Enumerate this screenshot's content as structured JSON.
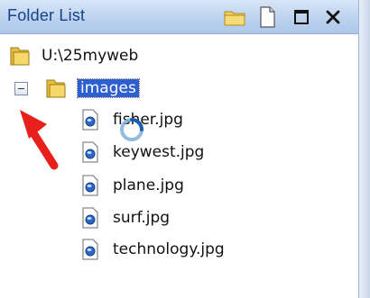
{
  "panel": {
    "title": "Folder List",
    "toolbar": {
      "folder_icon": "folder-icon",
      "file_icon": "new-file-icon",
      "maximize_icon": "maximize-icon",
      "close_label": "✕"
    }
  },
  "tree": {
    "root": {
      "label": "U:\\25myweb",
      "icon": "folder-icon"
    },
    "folder": {
      "label": "images",
      "expanded": true,
      "selected": true,
      "icon": "folder-icon"
    },
    "files": [
      {
        "label": "fisher.jpg",
        "icon": "image-file-icon"
      },
      {
        "label": "keywest.jpg",
        "icon": "image-file-icon"
      },
      {
        "label": "plane.jpg",
        "icon": "image-file-icon"
      },
      {
        "label": "surf.jpg",
        "icon": "image-file-icon"
      },
      {
        "label": "technology.jpg",
        "icon": "image-file-icon"
      }
    ]
  },
  "colors": {
    "title_text": "#15428b",
    "selection_bg": "#2e5fd1",
    "arrow": "#e8201c",
    "folder": "#e9c44c"
  }
}
